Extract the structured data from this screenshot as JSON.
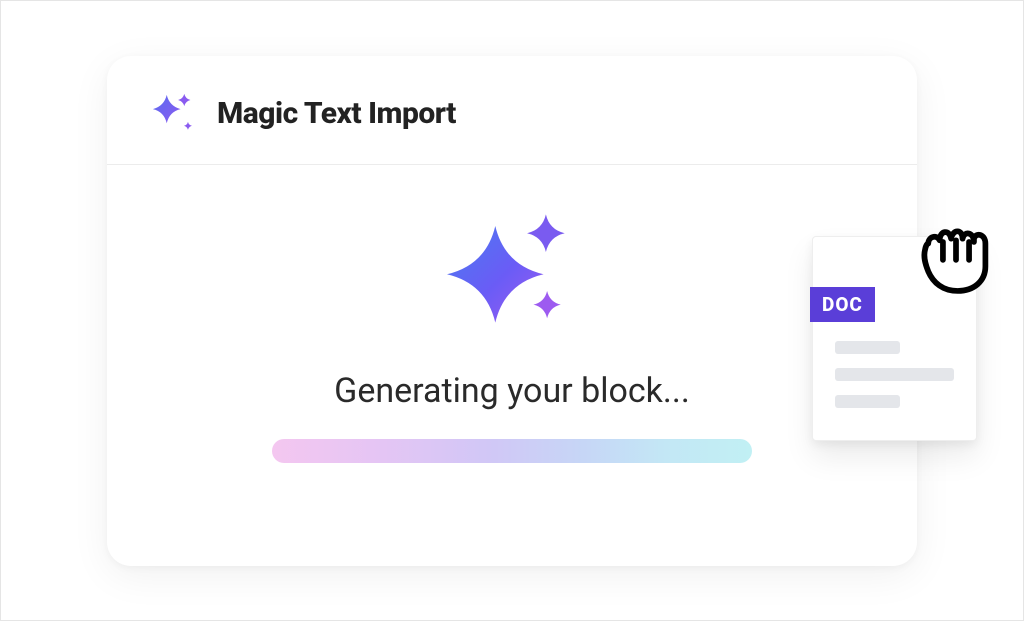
{
  "modal": {
    "title": "Magic Text Import",
    "status": "Generating your block...",
    "doc_badge": "DOC"
  },
  "colors": {
    "accent_start": "#6a5cf6",
    "accent_end": "#8b5cf6",
    "badge_bg": "#5a3ed8"
  }
}
